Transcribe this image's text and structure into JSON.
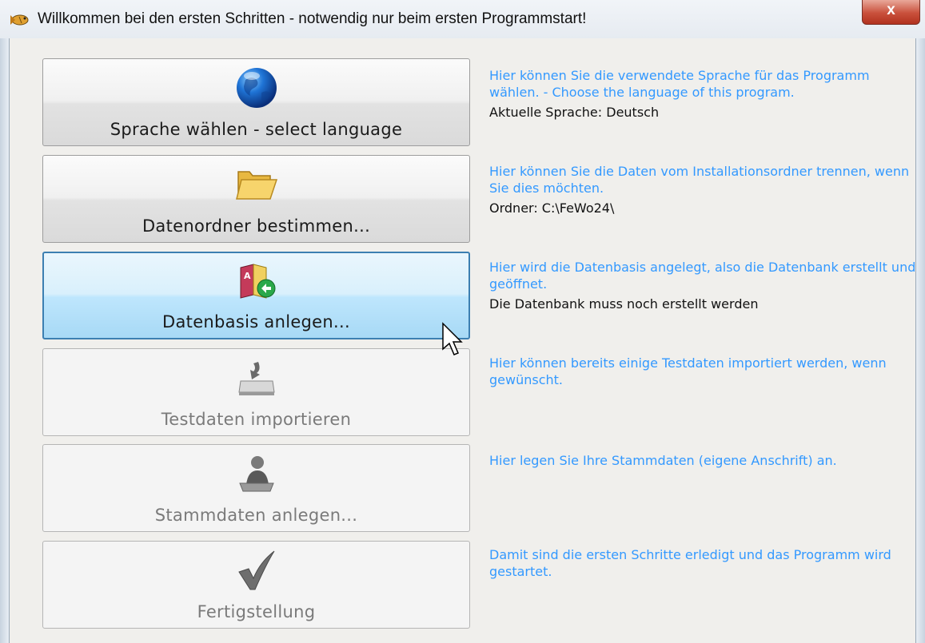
{
  "window": {
    "title": "Willkommen bei den ersten Schritten - notwendig nur beim ersten Programmstart!",
    "close_label": "x",
    "app_icon": "fish-logo-icon"
  },
  "steps": [
    {
      "label": "Sprache wählen - select language",
      "icon": "globe-icon",
      "state": "normal",
      "description": "Hier können Sie die verwendete Sprache für das Programm wählen. - Choose the language of this program.",
      "status": "Aktuelle Sprache: Deutsch"
    },
    {
      "label": "Datenordner bestimmen...",
      "icon": "folder-icon",
      "state": "normal",
      "description": "Hier können Sie die Daten vom Installationsordner trennen, wenn Sie dies möchten.",
      "status": "Ordner: C:\\FeWo24\\"
    },
    {
      "label": "Datenbasis anlegen...",
      "icon": "database-book-icon",
      "state": "hover",
      "description": "Hier wird die Datenbasis angelegt, also die Datenbank erstellt und geöffnet.",
      "status": "Die Datenbank muss noch erstellt werden"
    },
    {
      "label": "Testdaten importieren",
      "icon": "disk-import-icon",
      "state": "disabled",
      "description": "Hier können bereits einige Testdaten importiert werden, wenn gewünscht."
    },
    {
      "label": "Stammdaten anlegen...",
      "icon": "person-desk-icon",
      "state": "disabled",
      "description": "Hier legen Sie Ihre Stammdaten (eigene Anschrift) an."
    },
    {
      "label": "Fertigstellung",
      "icon": "checkmark-icon",
      "state": "disabled",
      "description": "Damit sind die ersten Schritte erledigt und das Programm wird gestartet."
    }
  ],
  "colors": {
    "description_text": "#3399ff",
    "status_text": "#111111",
    "hover_button": "#bee6fd"
  }
}
